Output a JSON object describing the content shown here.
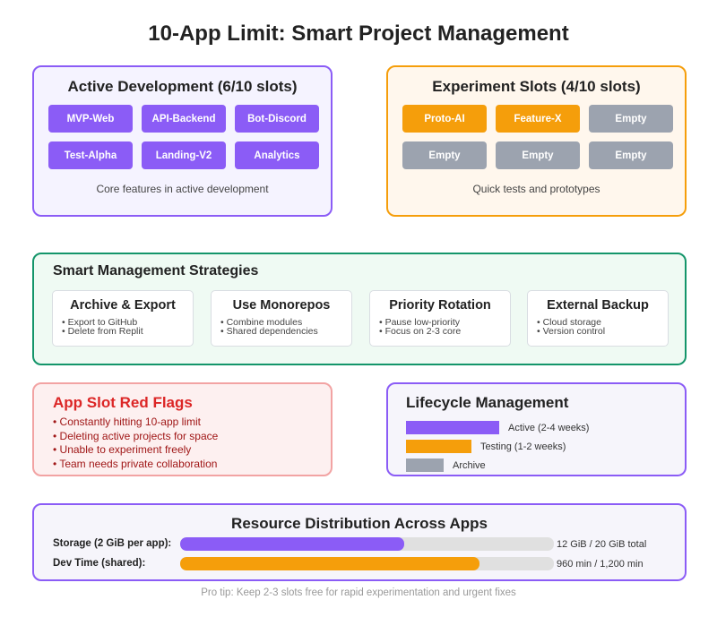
{
  "title": "10-App Limit: Smart Project Management",
  "active": {
    "title": "Active Development (6/10 slots)",
    "apps": [
      "MVP-Web",
      "API-Backend",
      "Bot-Discord",
      "Test-Alpha",
      "Landing-V2",
      "Analytics"
    ],
    "caption": "Core features in active development"
  },
  "experiment": {
    "title": "Experiment Slots (4/10 slots)",
    "slots": [
      "Proto-AI",
      "Feature-X",
      "Empty",
      "Empty",
      "Empty",
      "Empty"
    ],
    "caption": "Quick tests and prototypes"
  },
  "strategies": {
    "title": "Smart Management Strategies",
    "cards": [
      {
        "title": "Archive & Export",
        "items": [
          "Export to GitHub",
          "Delete from Replit"
        ]
      },
      {
        "title": "Use Monorepos",
        "items": [
          "Combine modules",
          "Shared dependencies"
        ]
      },
      {
        "title": "Priority Rotation",
        "items": [
          "Pause low-priority",
          "Focus on 2-3 core"
        ]
      },
      {
        "title": "External Backup",
        "items": [
          "Cloud storage",
          "Version control"
        ]
      }
    ]
  },
  "red_flags": {
    "title": "App Slot Red Flags",
    "items": [
      "Constantly hitting 10-app limit",
      "Deleting active projects for space",
      "Unable to experiment freely",
      "Team needs private collaboration"
    ]
  },
  "lifecycle": {
    "title": "Lifecycle Management",
    "stages": [
      {
        "label": "Active (2-4 weeks)",
        "color": "#8b5cf6",
        "level": 1.0
      },
      {
        "label": "Testing (1-2 weeks)",
        "color": "#f59e0b",
        "level": 0.7
      },
      {
        "label": "Archive",
        "color": "#9ca3af",
        "level": 0.4
      }
    ]
  },
  "resources": {
    "title": "Resource Distribution Across Apps",
    "rows": [
      {
        "label": "Storage (2 GiB per app):",
        "value_text": "12 GiB / 20 GiB total",
        "fraction": 0.6,
        "color": "#8b5cf6"
      },
      {
        "label": "Dev Time (shared):",
        "value_text": "960 min / 1,200 min",
        "fraction": 0.8,
        "color": "#f59e0b"
      }
    ]
  },
  "tip": "Pro tip: Keep 2-3 slots free for rapid experimentation and urgent fixes"
}
